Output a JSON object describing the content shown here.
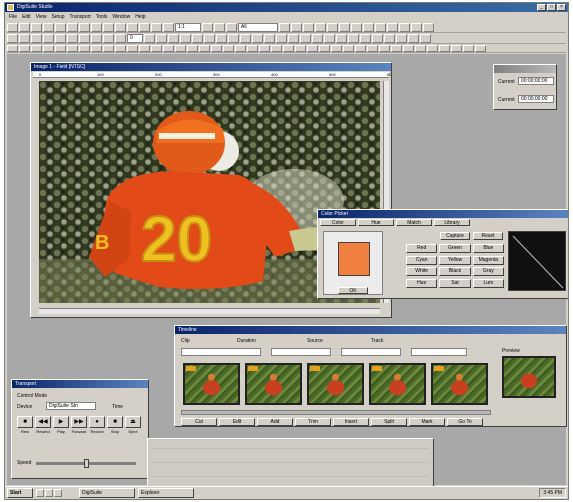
{
  "app": {
    "title": "DigiSuite Studio"
  },
  "menu": [
    "File",
    "Edit",
    "View",
    "Setup",
    "Transport",
    "Tools",
    "Window",
    "Help"
  ],
  "toolbar": {
    "row1_field1": "1:1",
    "row1_field2": "All",
    "row2_field": "0"
  },
  "video_window": {
    "title": "Image 1 - Field [NTSC]",
    "jersey_number": "20",
    "jersey_letter": "B",
    "ruler_marks": [
      "0",
      "100",
      "200",
      "300",
      "400",
      "500",
      "600"
    ]
  },
  "timecode_window": {
    "rows": [
      {
        "label": "Current",
        "value": "00:00:00:00"
      },
      {
        "label": "Current",
        "value": "00:00:00:00"
      }
    ]
  },
  "color_window": {
    "title": "Color Picker",
    "tabs": [
      "Color",
      "Hue",
      "Match",
      "Library"
    ],
    "swatch_color": "#f08040",
    "grid_buttons": [
      "Red",
      "Green",
      "Blue",
      "Cyan",
      "Yellow",
      "Magenta",
      "White",
      "Black",
      "Gray",
      "Hue",
      "Sat",
      "Lum"
    ],
    "action_buttons": [
      "Capture",
      "Reset"
    ],
    "ok_label": "OK"
  },
  "clip_window": {
    "title": "Timeline",
    "header_labels": [
      "Clip",
      "Duration",
      "Source",
      "Track"
    ],
    "thumb_count": 5,
    "bottom_buttons": [
      "Cut",
      "Edit",
      "Add",
      "Trim",
      "Insert",
      "Split",
      "Mark",
      "Go To"
    ],
    "preview_label": "Preview"
  },
  "transport_window": {
    "title": "Transport",
    "labels": {
      "device": "Device",
      "mode": "Control Mode",
      "speed": "Speed",
      "time": "Time"
    },
    "field": "DigiSuite Stn",
    "buttons": [
      "Rew",
      "Rewind",
      "Play",
      "Forward",
      "Record",
      "Stop",
      "Eject"
    ]
  },
  "taskbar": {
    "start": "Start",
    "tasks": [
      "DigiSuite",
      "Explorer"
    ],
    "clock": "3:45 PM"
  }
}
